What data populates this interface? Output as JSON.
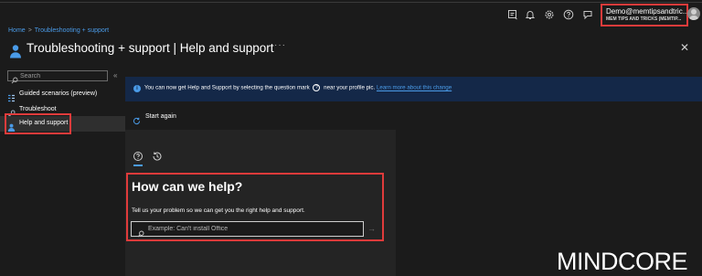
{
  "topbar": {
    "icons": [
      "feedback-icon",
      "bell-icon",
      "gear-icon",
      "help-icon",
      "chat-icon"
    ],
    "account": {
      "name": "Demo@memtipsandtric...",
      "tenant": "MEM TIPS AND TRICKS (MEMTIP..."
    }
  },
  "breadcrumb": {
    "home": "Home",
    "separator": ">",
    "current": "Troubleshooting + support"
  },
  "page": {
    "title": "Troubleshooting + support | Help and support",
    "more": "···",
    "close": "✕"
  },
  "sidebar": {
    "search_placeholder": "Search",
    "collapse": "«",
    "items": [
      {
        "label": "Guided scenarios (preview)",
        "icon": "guided-scenarios-icon"
      },
      {
        "label": "Troubleshoot",
        "icon": "wrench-icon"
      },
      {
        "label": "Help and support",
        "icon": "person-icon",
        "selected": true
      }
    ]
  },
  "infobar": {
    "text_before": "You can now get Help and Support by selecting the question mark",
    "text_after": "near your profile pic.",
    "link": "Learn more about this change"
  },
  "start_again": "Start again",
  "help": {
    "title": "How can we help?",
    "subtitle": "Tell us your problem so we can get you the right help and support.",
    "input_placeholder": "Example: Can't install Office",
    "submit": "→"
  },
  "watermark": "MINDCORE",
  "colors": {
    "background": "#1b1b1b",
    "accent": "#4a9be8",
    "highlight": "#e03b3b",
    "info_bar": "#142848"
  }
}
